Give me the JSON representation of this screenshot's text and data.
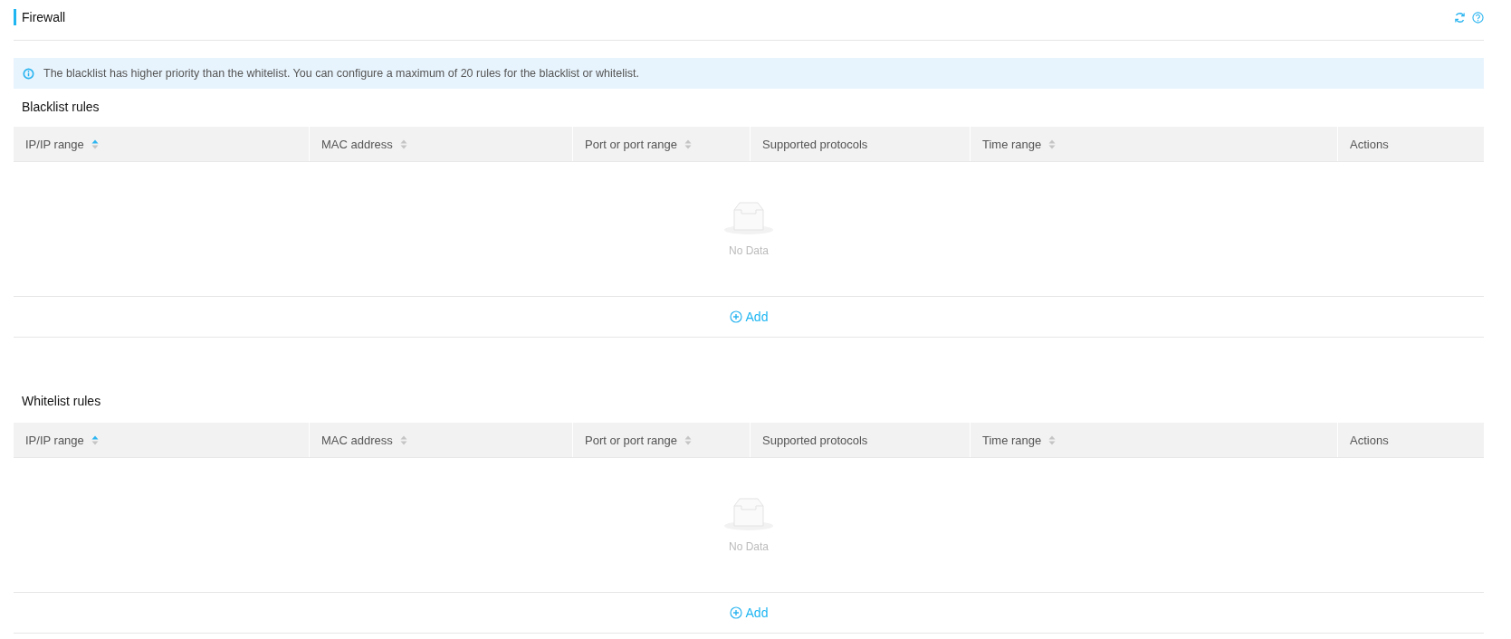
{
  "page": {
    "title": "Firewall"
  },
  "notice": "The blacklist has higher priority than the whitelist. You can configure a maximum of 20 rules for the blacklist or whitelist.",
  "tables": [
    {
      "title": "Blacklist rules",
      "columns": [
        {
          "label": "IP/IP range",
          "sortable": true,
          "sort_active": true
        },
        {
          "label": "MAC address",
          "sortable": true,
          "sort_active": false
        },
        {
          "label": "Port or port range",
          "sortable": true,
          "sort_active": false
        },
        {
          "label": "Supported protocols",
          "sortable": false
        },
        {
          "label": "Time range",
          "sortable": true,
          "sort_active": false
        },
        {
          "label": "Actions",
          "sortable": false
        }
      ],
      "empty_text": "No Data",
      "add_label": "Add"
    },
    {
      "title": "Whitelist rules",
      "columns": [
        {
          "label": "IP/IP range",
          "sortable": true,
          "sort_active": true
        },
        {
          "label": "MAC address",
          "sortable": true,
          "sort_active": false
        },
        {
          "label": "Port or port range",
          "sortable": true,
          "sort_active": false
        },
        {
          "label": "Supported protocols",
          "sortable": false
        },
        {
          "label": "Time range",
          "sortable": true,
          "sort_active": false
        },
        {
          "label": "Actions",
          "sortable": false
        }
      ],
      "empty_text": "No Data",
      "add_label": "Add"
    }
  ]
}
